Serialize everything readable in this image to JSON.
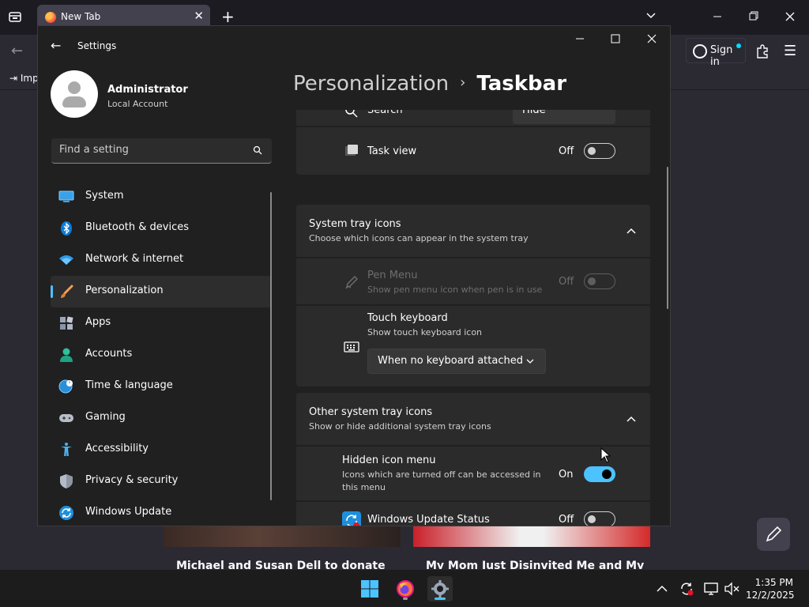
{
  "browser": {
    "tab_title": "New Tab",
    "tab_close": "✕",
    "new_tab": "+",
    "signin_label": "Sign in",
    "bookmark_import": "Imp",
    "stories": [
      {
        "title": "Michael and Susan Dell to donate"
      },
      {
        "title": "My Mom Just Disinvited Me and My"
      }
    ]
  },
  "settings": {
    "window_title": "Settings",
    "user": {
      "name": "Administrator",
      "account_type": "Local Account"
    },
    "search_placeholder": "Find a setting",
    "nav": [
      {
        "label": "System",
        "icon": "monitor-icon"
      },
      {
        "label": "Bluetooth & devices",
        "icon": "bluetooth-icon"
      },
      {
        "label": "Network & internet",
        "icon": "wifi-icon"
      },
      {
        "label": "Personalization",
        "icon": "brush-icon",
        "active": true
      },
      {
        "label": "Apps",
        "icon": "apps-icon"
      },
      {
        "label": "Accounts",
        "icon": "person-icon"
      },
      {
        "label": "Time & language",
        "icon": "globe-clock-icon"
      },
      {
        "label": "Gaming",
        "icon": "gamepad-icon"
      },
      {
        "label": "Accessibility",
        "icon": "accessibility-icon"
      },
      {
        "label": "Privacy & security",
        "icon": "shield-icon"
      },
      {
        "label": "Windows Update",
        "icon": "update-icon"
      }
    ],
    "breadcrumb": {
      "parent": "Personalization",
      "separator": "›",
      "current": "Taskbar"
    },
    "taskbar_items": {
      "search": {
        "label": "Search",
        "value": "Hide"
      },
      "task_view": {
        "label": "Task view",
        "state": "Off",
        "on": false
      }
    },
    "system_tray": {
      "title": "System tray icons",
      "description": "Choose which icons can appear in the system tray",
      "pen_menu": {
        "label": "Pen Menu",
        "description": "Show pen menu icon when pen is in use",
        "state": "Off",
        "on": false,
        "disabled": true
      },
      "touch_keyboard": {
        "label": "Touch keyboard",
        "description": "Show touch keyboard icon",
        "dropdown_value": "When no keyboard attached"
      }
    },
    "other_tray": {
      "title": "Other system tray icons",
      "description": "Show or hide additional system tray icons",
      "hidden_icon_menu": {
        "label": "Hidden icon menu",
        "description": "Icons which are turned off can be accessed in this menu",
        "state": "On",
        "on": true
      },
      "windows_update_status": {
        "label": "Windows Update Status",
        "state": "Off",
        "on": false
      }
    }
  },
  "taskbar": {
    "time": "1:35 PM",
    "date": "12/2/2025",
    "apps": [
      {
        "name": "firefox-icon"
      },
      {
        "name": "settings-gear-icon",
        "active": true
      }
    ]
  },
  "colors": {
    "accent": "#4cc2ff",
    "window_bg": "#202020",
    "card_bg": "#2b2b2b"
  }
}
